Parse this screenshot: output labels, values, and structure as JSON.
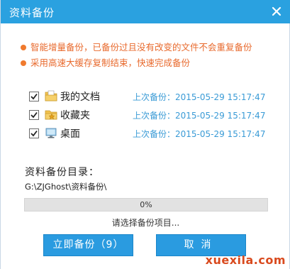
{
  "window": {
    "title": "资料备份",
    "accent_color": "#2aa1e0",
    "close_icon": "close-icon"
  },
  "tips": [
    "智能增量备份，已备份过且没有改变的文件不会重复备份",
    "采用高速大缓存复制结束，快速完成备份"
  ],
  "items": [
    {
      "name": "我的文档",
      "icon": "documents-folder-icon",
      "checked": true,
      "time": "上次备份：2015-05-29 15:17:47"
    },
    {
      "name": "收藏夹",
      "icon": "favorites-folder-icon",
      "checked": true,
      "time": "上次备份：2015-05-29 15:17:47"
    },
    {
      "name": "桌面",
      "icon": "desktop-icon",
      "checked": true,
      "time": "上次备份：2015-05-29 15:17:47"
    }
  ],
  "directory": {
    "label": "资料备份目录：",
    "path": "G:\\ZJGhost\\资料备份\\"
  },
  "progress": {
    "value": 0,
    "label": "0%"
  },
  "status_text": "请选择备份项目...",
  "buttons": {
    "backup_label": "立即备份（9）",
    "cancel_label": "取消"
  },
  "watermark": "xuexila.com"
}
